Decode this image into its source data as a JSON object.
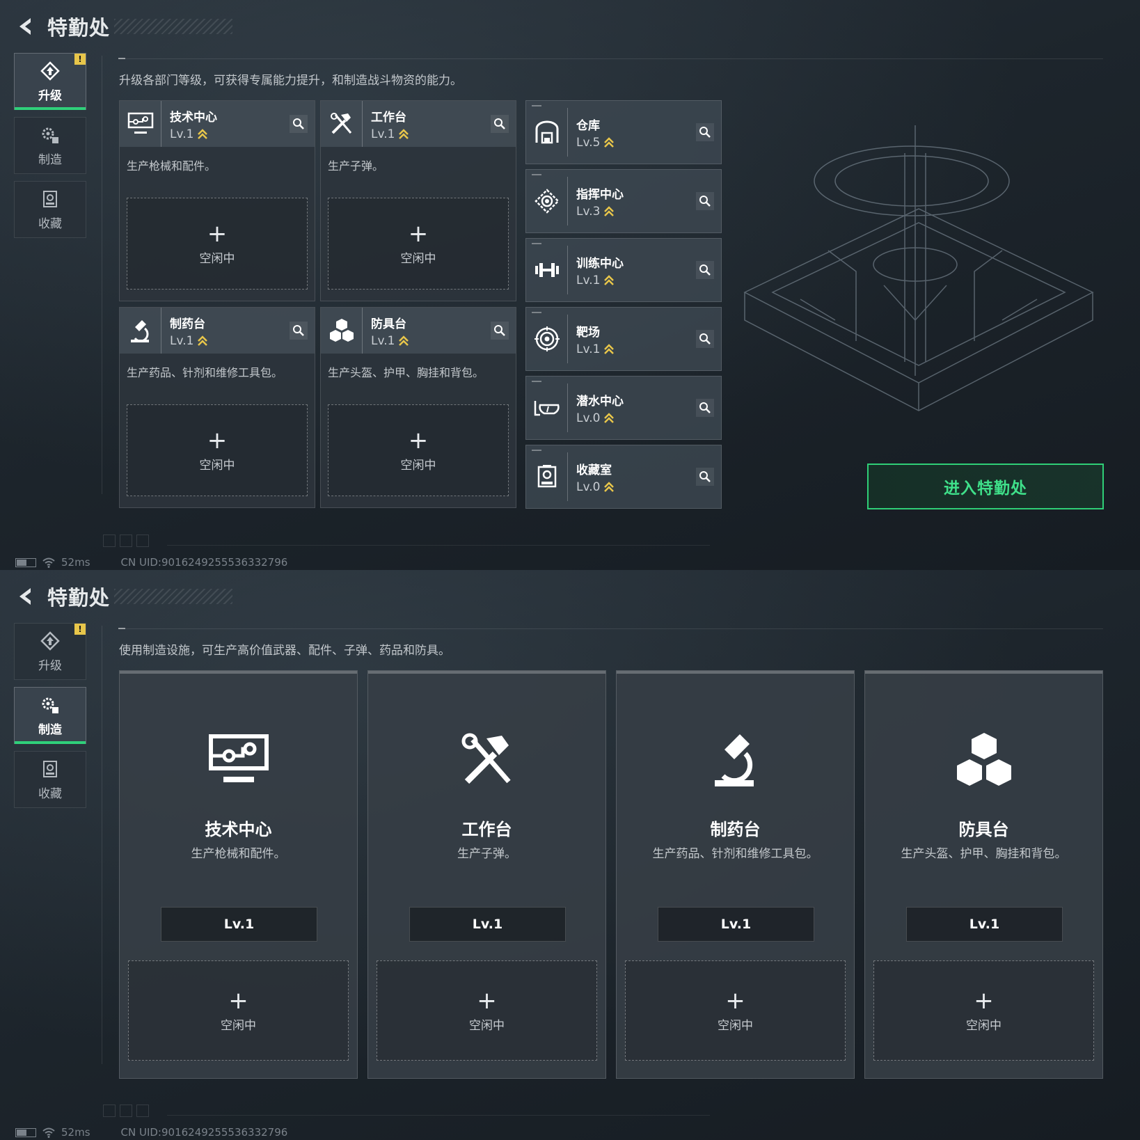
{
  "colors": {
    "accent_green": "#2fd07a",
    "badge_yellow": "#e8c64a",
    "level_up_yellow": "#e8c64a"
  },
  "top": {
    "title": "特勤处",
    "nav": [
      {
        "label": "升级",
        "icon": "upgrade-icon",
        "active": true,
        "alert": "!"
      },
      {
        "label": "制造",
        "icon": "gear-craft-icon",
        "active": false
      },
      {
        "label": "收藏",
        "icon": "collection-icon",
        "active": false
      }
    ],
    "description": "升级各部门等级，可获得专属能力提升，和制造战斗物资的能力。",
    "departments": [
      {
        "name": "技术中心",
        "level": "Lv.1",
        "desc": "生产枪械和配件。",
        "slot": "空闲中",
        "icon": "tech-center-icon"
      },
      {
        "name": "工作台",
        "level": "Lv.1",
        "desc": "生产子弹。",
        "slot": "空闲中",
        "icon": "workbench-icon"
      },
      {
        "name": "制药台",
        "level": "Lv.1",
        "desc": "生产药品、针剂和维修工具包。",
        "slot": "空闲中",
        "icon": "pharmacy-icon"
      },
      {
        "name": "防具台",
        "level": "Lv.1",
        "desc": "生产头盔、护甲、胸挂和背包。",
        "slot": "空闲中",
        "icon": "armor-icon"
      }
    ],
    "facilities": [
      {
        "name": "仓库",
        "level": "Lv.5",
        "icon": "warehouse-icon"
      },
      {
        "name": "指挥中心",
        "level": "Lv.3",
        "icon": "command-center-icon"
      },
      {
        "name": "训练中心",
        "level": "Lv.1",
        "icon": "training-icon"
      },
      {
        "name": "靶场",
        "level": "Lv.1",
        "icon": "shooting-range-icon"
      },
      {
        "name": "潜水中心",
        "level": "Lv.0",
        "icon": "diving-icon"
      },
      {
        "name": "收藏室",
        "level": "Lv.0",
        "icon": "collection-room-icon"
      }
    ],
    "enter_button": "进入特勤处",
    "status": {
      "ping": "52ms",
      "uid": "CN UID:9016249255536332796"
    }
  },
  "bottom": {
    "title": "特勤处",
    "nav": [
      {
        "label": "升级",
        "icon": "upgrade-icon",
        "active": false,
        "alert": "!"
      },
      {
        "label": "制造",
        "icon": "gear-craft-icon",
        "active": true
      },
      {
        "label": "收藏",
        "icon": "collection-icon",
        "active": false
      }
    ],
    "description": "使用制造设施，可生产高价值武器、配件、子弹、药品和防具。",
    "stations": [
      {
        "name": "技术中心",
        "desc": "生产枪械和配件。",
        "level": "Lv.1",
        "slot": "空闲中",
        "icon": "tech-center-icon"
      },
      {
        "name": "工作台",
        "desc": "生产子弹。",
        "level": "Lv.1",
        "slot": "空闲中",
        "icon": "workbench-icon"
      },
      {
        "name": "制药台",
        "desc": "生产药品、针剂和维修工具包。",
        "level": "Lv.1",
        "slot": "空闲中",
        "icon": "pharmacy-icon"
      },
      {
        "name": "防具台",
        "desc": "生产头盔、护甲、胸挂和背包。",
        "level": "Lv.1",
        "slot": "空闲中",
        "icon": "armor-icon"
      }
    ],
    "status": {
      "ping": "52ms",
      "uid": "CN UID:9016249255536332796"
    }
  }
}
